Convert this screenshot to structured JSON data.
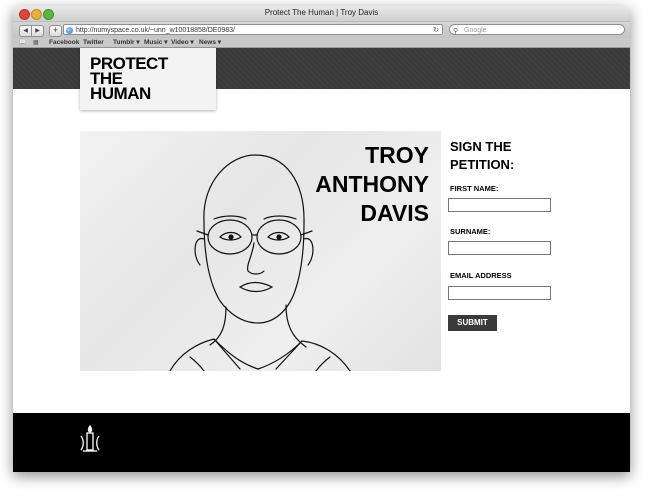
{
  "window": {
    "title": "Protect The Human | Troy Davis"
  },
  "toolbar": {
    "back": "◀",
    "forward": "▶",
    "add": "+",
    "url": "http://numyspace.co.uk/~unn_w10018858/DE0983/",
    "search_placeholder": "Google"
  },
  "bookmarks": [
    "Facebook",
    "Twitter",
    "Tumblr ▾",
    "Music ▾",
    "Video ▾",
    "News ▾"
  ],
  "site": {
    "logo_lines": [
      "PROTECT",
      "THE",
      "HUMAN"
    ],
    "person_name": [
      "TROY",
      "ANTHONY",
      "DAVIS"
    ]
  },
  "petition": {
    "title_lines": [
      "SIGN THE",
      "PETITION:"
    ],
    "first_name_label": "FIRST NAME:",
    "surname_label": "SURNAME:",
    "email_label": "EMAIL ADDRESS",
    "submit_label": "SUBMIT"
  },
  "colors": {
    "banner": "#3e3e3e",
    "footer": "#000000",
    "button": "#3a3a3a"
  },
  "icons": {
    "footer_logo": "amnesty-candle-icon"
  }
}
